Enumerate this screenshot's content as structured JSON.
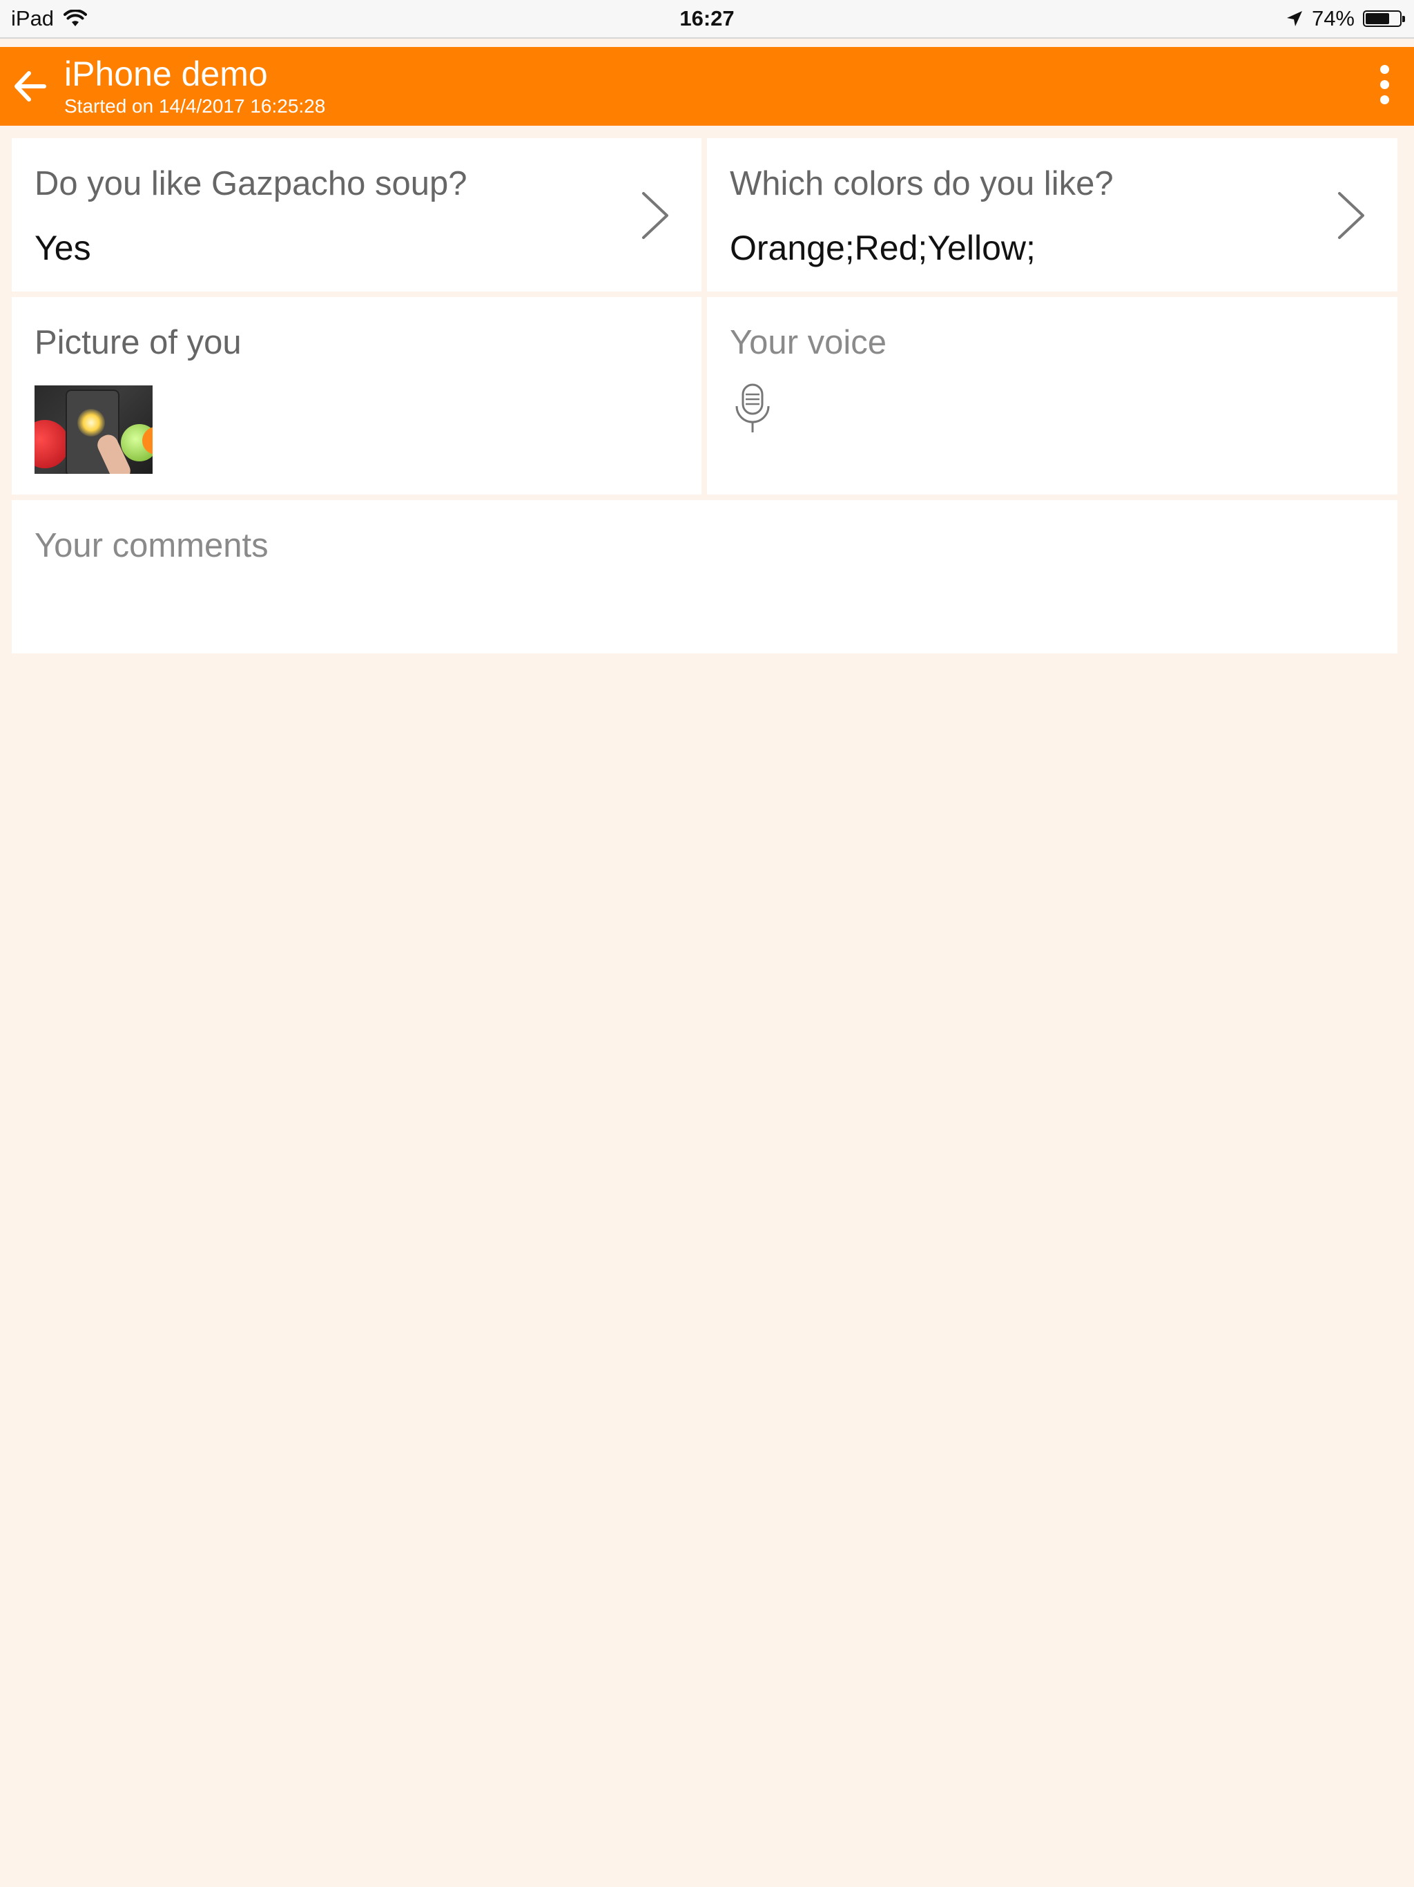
{
  "status_bar": {
    "device": "iPad",
    "time": "16:27",
    "battery_text": "74%",
    "battery_level": 0.74,
    "icons": [
      "wifi-icon",
      "location-arrow-icon",
      "battery-icon"
    ]
  },
  "app_bar": {
    "title": "iPhone demo",
    "subtitle": "Started on 14/4/2017 16:25:28",
    "color": "#ff7f00",
    "icons": [
      "back-arrow-icon",
      "more-vertical-icon"
    ]
  },
  "cards": {
    "gazpacho": {
      "label": "Do you like Gazpacho soup?",
      "value": "Yes"
    },
    "colors": {
      "label": "Which colors do you like?",
      "value": "Orange;Red;Yellow;"
    },
    "picture": {
      "label": "Picture of you"
    },
    "voice": {
      "label": "Your voice",
      "icon": "microphone-icon"
    },
    "comments": {
      "label": "Your comments"
    }
  },
  "colors": {
    "background": "#fdf3ea",
    "card": "#ffffff",
    "accent": "#ff7f00"
  }
}
